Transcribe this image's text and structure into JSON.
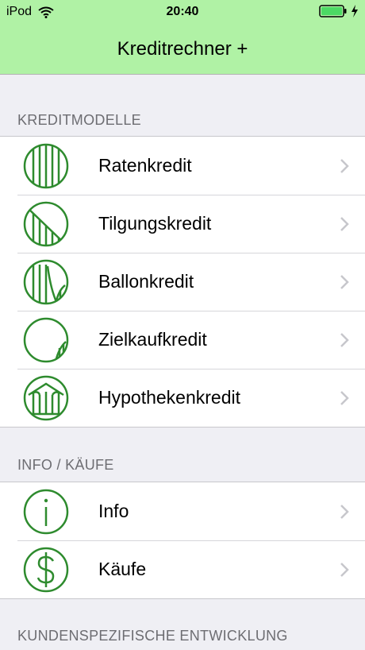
{
  "status": {
    "device": "iPod",
    "time": "20:40"
  },
  "nav": {
    "title": "Kreditrechner +"
  },
  "sections": [
    {
      "header": "KREDITMODELLE",
      "items": [
        {
          "label": "Ratenkredit",
          "icon": "ratenkredit-icon"
        },
        {
          "label": "Tilgungskredit",
          "icon": "tilgungskredit-icon"
        },
        {
          "label": "Ballonkredit",
          "icon": "ballonkredit-icon"
        },
        {
          "label": "Zielkaufkredit",
          "icon": "zielkaufkredit-icon"
        },
        {
          "label": "Hypothekenkredit",
          "icon": "hypothekenkredit-icon"
        }
      ]
    },
    {
      "header": "INFO / KÄUFE",
      "items": [
        {
          "label": "Info",
          "icon": "info-icon"
        },
        {
          "label": "Käufe",
          "icon": "dollar-icon"
        }
      ]
    },
    {
      "header": "KUNDENSPEZIFISCHE ENTWICKLUNG",
      "items": []
    }
  ],
  "colors": {
    "accent_green": "#2e8b2e",
    "header_green": "#b0f2a5"
  }
}
